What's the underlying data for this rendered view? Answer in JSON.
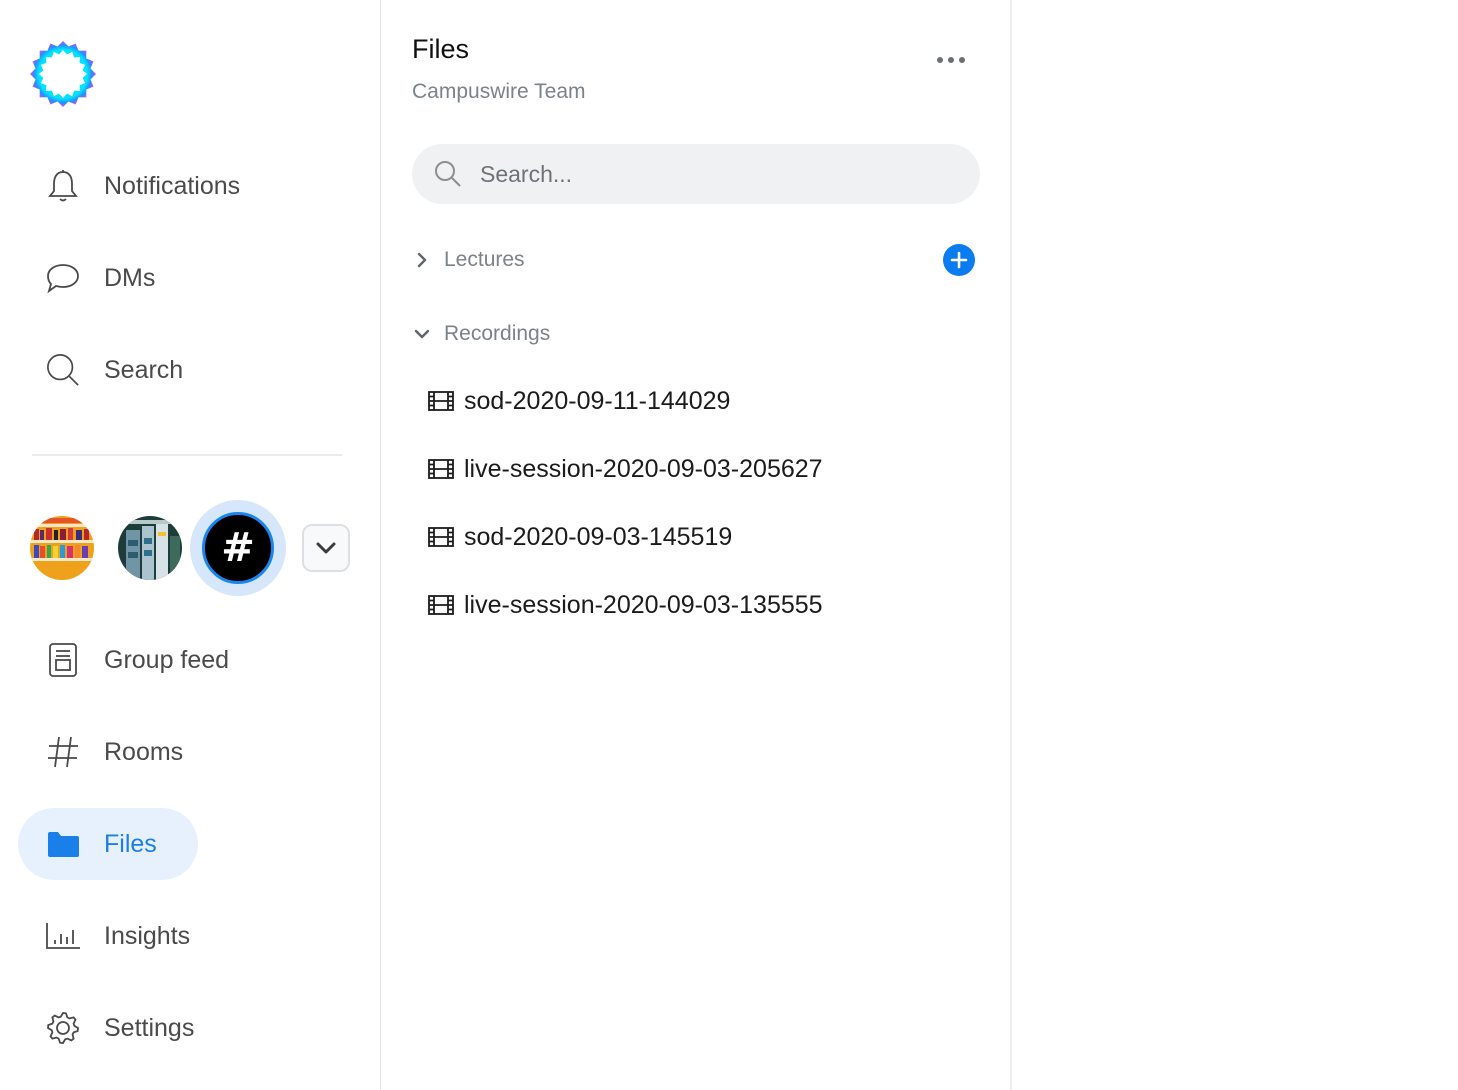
{
  "sidebar": {
    "logo": "campuswire-logo",
    "nav_top": [
      {
        "label": "Notifications",
        "icon": "bell-icon"
      },
      {
        "label": "DMs",
        "icon": "chat-bubble-icon"
      },
      {
        "label": "Search",
        "icon": "search-icon"
      }
    ],
    "groups": [
      {
        "name": "group-bookshelf",
        "icon": "bookshelf-image"
      },
      {
        "name": "group-books",
        "icon": "books-image"
      },
      {
        "name": "group-hashtag",
        "icon_text": "#",
        "active": true
      }
    ],
    "nav_bottom": [
      {
        "label": "Group feed",
        "icon": "feed-icon"
      },
      {
        "label": "Rooms",
        "icon": "hash-icon"
      },
      {
        "label": "Files",
        "icon": "folder-icon",
        "active": true
      },
      {
        "label": "Insights",
        "icon": "bar-chart-icon"
      },
      {
        "label": "Settings",
        "icon": "gear-icon"
      }
    ]
  },
  "panel": {
    "title": "Files",
    "subtitle": "Campuswire Team",
    "search_placeholder": "Search...",
    "folders": [
      {
        "label": "Lectures",
        "expanded": false
      },
      {
        "label": "Recordings",
        "expanded": true
      }
    ],
    "files": [
      "sod-2020-09-11-144029",
      "live-session-2020-09-03-205627",
      "sod-2020-09-03-145519",
      "live-session-2020-09-03-135555"
    ]
  },
  "colors": {
    "accent": "#1a7fe8",
    "active_bg": "#e7f1fd",
    "add_button": "#0a7cf0"
  }
}
